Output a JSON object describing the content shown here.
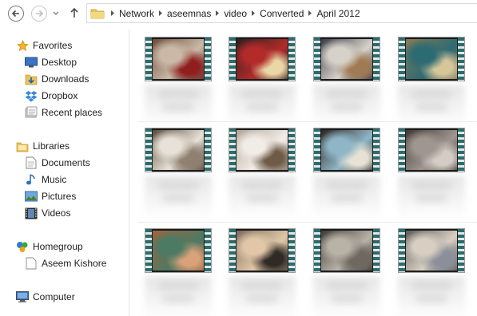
{
  "toolbar": {
    "back_icon": "back-arrow-icon",
    "forward_icon": "forward-arrow-icon",
    "recent_icon": "chevron-down-icon",
    "up_icon": "up-arrow-icon"
  },
  "address_bar": {
    "icon": "folder-icon",
    "crumbs": [
      "Network",
      "aseemnas",
      "video",
      "Converted",
      "April 2012"
    ]
  },
  "nav": {
    "favorites": {
      "label": "Favorites",
      "icon": "star-icon"
    },
    "favorites_items": [
      {
        "label": "Desktop",
        "icon": "desktop-icon"
      },
      {
        "label": "Downloads",
        "icon": "downloads-icon"
      },
      {
        "label": "Dropbox",
        "icon": "dropbox-icon"
      },
      {
        "label": "Recent places",
        "icon": "recent-places-icon"
      }
    ],
    "libraries": {
      "label": "Libraries",
      "icon": "libraries-icon"
    },
    "libraries_items": [
      {
        "label": "Documents",
        "icon": "documents-icon"
      },
      {
        "label": "Music",
        "icon": "music-icon"
      },
      {
        "label": "Pictures",
        "icon": "pictures-icon"
      },
      {
        "label": "Videos",
        "icon": "videos-icon"
      }
    ],
    "homegroup": {
      "label": "Homegroup",
      "icon": "homegroup-icon"
    },
    "homegroup_items": [
      {
        "label": "Aseem Kishore",
        "icon": "user-icon"
      }
    ],
    "computer": {
      "label": "Computer",
      "icon": "computer-icon"
    }
  },
  "videos": [
    {
      "icon": "video-thumbnail",
      "palette": [
        "#6e4a3a",
        "#c9b9a6",
        "#8f1e1e"
      ]
    },
    {
      "icon": "video-thumbnail",
      "palette": [
        "#2a1f1e",
        "#b22a2a",
        "#e9d8a6"
      ]
    },
    {
      "icon": "video-thumbnail",
      "palette": [
        "#3b3a4a",
        "#d7d2c9",
        "#a07a52"
      ]
    },
    {
      "icon": "video-thumbnail",
      "palette": [
        "#8a7a55",
        "#2d6b73",
        "#d7c69a"
      ]
    },
    {
      "icon": "video-thumbnail",
      "palette": [
        "#5a4c3c",
        "#e7e1d7",
        "#8f8070"
      ]
    },
    {
      "icon": "video-thumbnail",
      "palette": [
        "#b1a598",
        "#f1ece6",
        "#6e5a46"
      ]
    },
    {
      "icon": "video-thumbnail",
      "palette": [
        "#2b2620",
        "#8fb6c7",
        "#e8e2d4"
      ]
    },
    {
      "icon": "video-thumbnail",
      "palette": [
        "#403833",
        "#9f9690",
        "#d3cdc4"
      ]
    },
    {
      "icon": "video-thumbnail",
      "palette": [
        "#a4623b",
        "#4c7a63",
        "#d9a27a"
      ]
    },
    {
      "icon": "video-thumbnail",
      "palette": [
        "#7a6a5c",
        "#e1c7a7",
        "#2f2a25"
      ]
    },
    {
      "icon": "video-thumbnail",
      "palette": [
        "#3d3a35",
        "#b9b2a7",
        "#6f6860"
      ]
    },
    {
      "icon": "video-thumbnail",
      "palette": [
        "#5c5a58",
        "#d8cfc2",
        "#8a8f99"
      ]
    }
  ],
  "colors": {
    "film_strip": "#2e6b6b",
    "divider": "#e5e5e5"
  }
}
